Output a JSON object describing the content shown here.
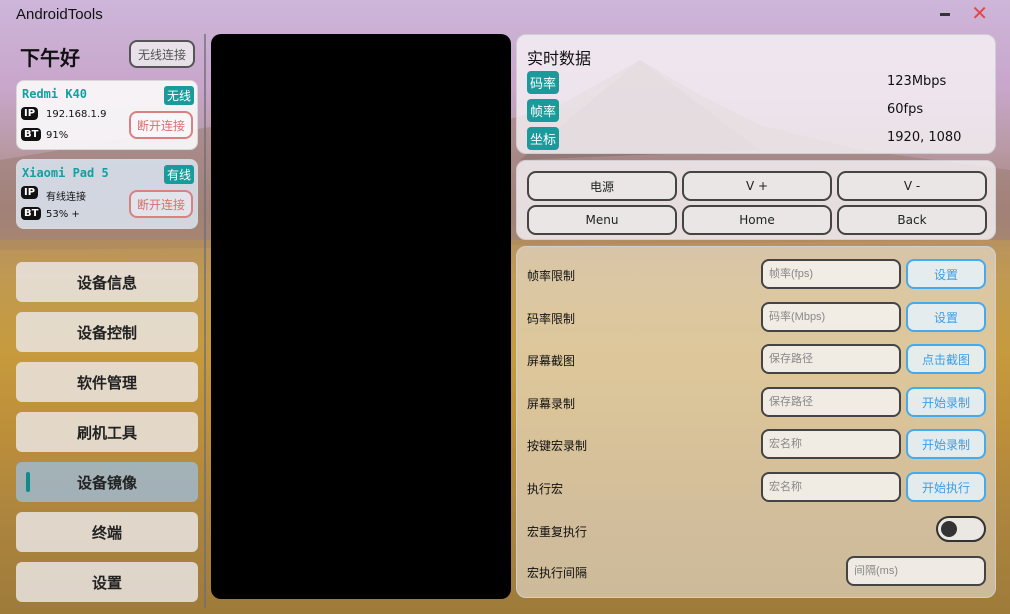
{
  "window": {
    "title": "AndroidTools",
    "minimize_icon": "minimize-icon",
    "close_icon": "close-icon"
  },
  "sidebar": {
    "greeting": "下午好",
    "wireless_connect_label": "无线连接",
    "devices": [
      {
        "name": "Redmi K40",
        "connection": "无线",
        "ip_tag": "IP",
        "ip": "192.168.1.9",
        "bt_tag": "BT",
        "battery": "91%",
        "disconnect_label": "断开连接"
      },
      {
        "name": "Xiaomi Pad 5",
        "connection": "有线",
        "ip_tag": "IP",
        "ip": "有线连接",
        "bt_tag": "BT",
        "battery": "53% +",
        "disconnect_label": "断开连接"
      }
    ],
    "nav": [
      {
        "label": "设备信息",
        "active": false
      },
      {
        "label": "设备控制",
        "active": false
      },
      {
        "label": "软件管理",
        "active": false
      },
      {
        "label": "刷机工具",
        "active": false
      },
      {
        "label": "设备镜像",
        "active": true
      },
      {
        "label": "终端",
        "active": false
      },
      {
        "label": "设置",
        "active": false
      }
    ]
  },
  "realtime": {
    "title": "实时数据",
    "rows": [
      {
        "label": "码率",
        "value": "123Mbps"
      },
      {
        "label": "帧率",
        "value": "60fps"
      },
      {
        "label": "坐标",
        "value": "1920, 1080"
      }
    ]
  },
  "controls": {
    "buttons": [
      "电源",
      "V +",
      "V -",
      "Menu",
      "Home",
      "Back"
    ]
  },
  "settings": {
    "fps_limit": {
      "label": "帧率限制",
      "placeholder": "帧率(fps)",
      "button": "设置"
    },
    "bitrate_limit": {
      "label": "码率限制",
      "placeholder": "码率(Mbps)",
      "button": "设置"
    },
    "screenshot": {
      "label": "屏幕截图",
      "placeholder": "保存路径",
      "button": "点击截图"
    },
    "screen_record": {
      "label": "屏幕录制",
      "placeholder": "保存路径",
      "button": "开始录制"
    },
    "macro_record": {
      "label": "按键宏录制",
      "placeholder": "宏名称",
      "button": "开始录制"
    },
    "macro_execute": {
      "label": "执行宏",
      "placeholder": "宏名称",
      "button": "开始执行"
    },
    "macro_repeat": {
      "label": "宏重复执行",
      "enabled": false
    },
    "macro_interval": {
      "label": "宏执行间隔",
      "placeholder": "间隔(ms)"
    }
  }
}
